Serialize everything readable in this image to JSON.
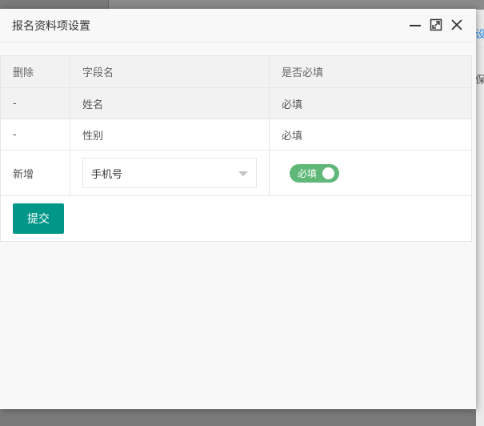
{
  "background": {
    "right_text_1": "设",
    "right_text_2": "保"
  },
  "dialog": {
    "title": "报名资料项设置",
    "controls": [
      "minimize-icon",
      "maximize-icon",
      "close-icon"
    ]
  },
  "table": {
    "headers": [
      "删除",
      "字段名",
      "是否必填"
    ],
    "rows": [
      {
        "delete": "-",
        "field": "姓名",
        "required": "必填"
      },
      {
        "delete": "-",
        "field": "性别",
        "required": "必填"
      }
    ],
    "add_row": {
      "label": "新增",
      "select_value": "手机号",
      "switch_label": "必填",
      "switch_on": true
    },
    "submit_label": "提交"
  },
  "colors": {
    "accent": "#009688",
    "switch_on": "#5fb878",
    "link": "#1e88e5"
  }
}
